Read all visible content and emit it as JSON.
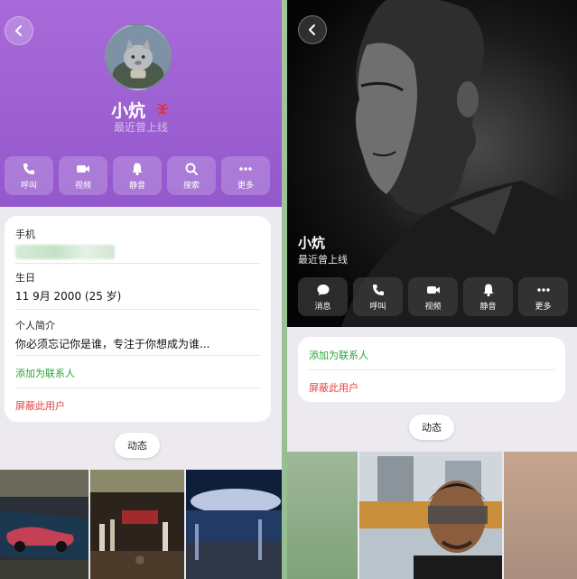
{
  "left": {
    "name": "小炕",
    "status": "最近曾上线",
    "actions": [
      {
        "label": "呼叫",
        "icon": "phone-icon"
      },
      {
        "label": "视频",
        "icon": "video-icon"
      },
      {
        "label": "静音",
        "icon": "bell-icon"
      },
      {
        "label": "搜索",
        "icon": "search-icon"
      },
      {
        "label": "更多",
        "icon": "more-icon"
      }
    ],
    "info": {
      "phone_label": "手机",
      "birthday_label": "生日",
      "birthday_value": "11 9月 2000 (25 岁)",
      "bio_label": "个人简介",
      "bio_value": "你必须忘记你是谁，专注于你想成为谁...",
      "add_contact": "添加为联系人",
      "block_user": "屏蔽此用户"
    },
    "posts_label": "动态"
  },
  "right": {
    "name": "小炕",
    "status": "最近曾上线",
    "actions": [
      {
        "label": "消息",
        "icon": "message-icon"
      },
      {
        "label": "呼叫",
        "icon": "phone-icon"
      },
      {
        "label": "视频",
        "icon": "video-icon"
      },
      {
        "label": "静音",
        "icon": "bell-icon"
      },
      {
        "label": "更多",
        "icon": "more-icon"
      }
    ],
    "add_contact": "添加为联系人",
    "block_user": "屏蔽此用户",
    "posts_label": "动态"
  },
  "colors": {
    "header_purple": "#9b5fd2",
    "link_green": "#2aa63a",
    "link_red": "#e14444"
  }
}
